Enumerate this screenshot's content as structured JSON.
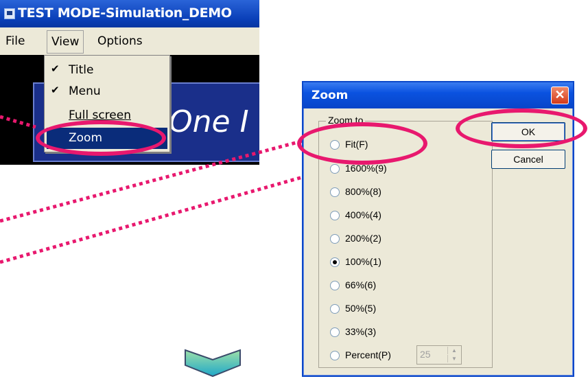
{
  "app": {
    "title": "TEST MODE-Simulation_DEMO",
    "menu": {
      "file": "File",
      "view": "View",
      "options": "Options"
    },
    "view_menu_items": [
      {
        "label": "Title",
        "checked": true
      },
      {
        "label": "Menu",
        "checked": true
      },
      {
        "label": "Full screen",
        "checked": false
      },
      {
        "label": "Zoom",
        "checked": false,
        "highlighted": true
      }
    ],
    "content_text": "One I"
  },
  "dialog": {
    "title": "Zoom",
    "group_label": "Zoom to",
    "options": [
      {
        "label": "Fit(F)",
        "checked": false
      },
      {
        "label": "1600%(9)",
        "checked": false
      },
      {
        "label": "800%(8)",
        "checked": false
      },
      {
        "label": "400%(4)",
        "checked": false
      },
      {
        "label": "200%(2)",
        "checked": false
      },
      {
        "label": "100%(1)",
        "checked": true
      },
      {
        "label": "66%(6)",
        "checked": false
      },
      {
        "label": "50%(5)",
        "checked": false
      },
      {
        "label": "33%(3)",
        "checked": false
      },
      {
        "label": "Percent(P)",
        "checked": false
      }
    ],
    "percent_value": "25",
    "ok_label": "OK",
    "cancel_label": "Cancel",
    "close_glyph": "✕"
  },
  "colors": {
    "highlight": "#e8186e",
    "titlebar_blue": "#0a52e0",
    "menu_selected": "#0a2c7a"
  },
  "icons": {
    "check": "checkmark-icon",
    "close": "close-icon",
    "arrow": "chevron-down-icon"
  }
}
